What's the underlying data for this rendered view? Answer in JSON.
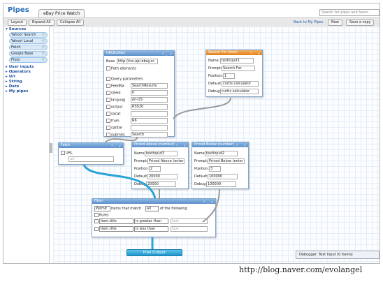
{
  "app": {
    "logo_text": "Pipes",
    "tab_title": "eBay Price Watch",
    "search_placeholder": "Search for pipes and feeds"
  },
  "toolbar": {
    "layout": "Layout",
    "expand_all": "Expand All",
    "collapse_all": "Collapse All",
    "back_link": "Back to My Pipes",
    "new": "New",
    "save_copy": "Save a copy"
  },
  "sidebar": {
    "sources_label": "Sources",
    "sources": [
      "Yahoo! Search",
      "Yahoo! Local",
      "Fetch",
      "Google Base",
      "Flickr"
    ],
    "categories": [
      "User inputs",
      "Operators",
      "Url",
      "String",
      "Date",
      "My pipes"
    ]
  },
  "url_builder": {
    "title": "URLBuilder",
    "base_label": "Base",
    "base_value": "http://rss.api.ebay.cc",
    "path_label": "Path elements",
    "query_label": "Query parameters",
    "params": [
      {
        "key": "FeedNa",
        "value": "SearchResults"
      },
      {
        "key": "siteid",
        "value": "0"
      },
      {
        "key": "languag",
        "value": "en-US"
      },
      {
        "key": "output",
        "value": "RSS20"
      },
      {
        "key": "sacat",
        "value": ""
      },
      {
        "key": "from",
        "value": "R6"
      },
      {
        "key": "satitle",
        "value": ""
      },
      {
        "key": "submits",
        "value": "Search"
      }
    ]
  },
  "search_for": {
    "title": "Search For (text)",
    "name_label": "Name:",
    "name_value": "textinput1",
    "prompt_label": "Prompt:",
    "prompt_value": "Search For",
    "position_label": "Position:",
    "position_value": "1",
    "default_label": "Default:",
    "default_value": "curtis calculator",
    "debug_label": "Debug:",
    "debug_value": "curtis calculator"
  },
  "fetch": {
    "title": "Fetch",
    "url_label": "URL",
    "url_placeholder": "url"
  },
  "priced_above": {
    "title": "Priced Above (number)",
    "name_label": "Name:",
    "name_value": "textinput3",
    "prompt_label": "Prompt:",
    "prompt_value": "Priced Above (enter a",
    "position_label": "Position:",
    "position_value": "2",
    "default_label": "Default:",
    "default_value": "20000",
    "debug_label": "Debug:",
    "debug_value": "20000"
  },
  "priced_below": {
    "title": "Priced Below (number)",
    "name_label": "Name:",
    "name_value": "textinput2",
    "prompt_label": "Prompt:",
    "prompt_value": "Priced Below (enter a",
    "position_label": "Position:",
    "position_value": "3",
    "default_label": "Default:",
    "default_value": "100000",
    "debug_label": "Debug:",
    "debug_value": "100000"
  },
  "filter": {
    "title": "Filter",
    "mode": "Permit",
    "items_text": "items that match",
    "match": "all",
    "following_text": "of the following",
    "rules_label": "Rules",
    "rules": [
      {
        "field": "item.title",
        "op": "is greater than",
        "value": "text"
      },
      {
        "field": "item.title",
        "op": "is less than",
        "value": "text"
      }
    ]
  },
  "output": {
    "label": "Pipe Output"
  },
  "debugger": {
    "label": "Debugger: Text Input (0 items)"
  },
  "watermark": "http://blog.naver.com/evolangel"
}
